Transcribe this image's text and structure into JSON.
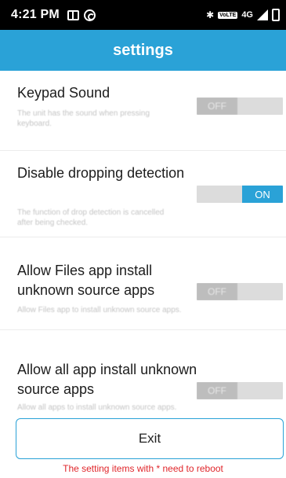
{
  "status_bar": {
    "time": "4:21 PM",
    "volte": "VoLTE",
    "network": "4G"
  },
  "header": {
    "title": "settings"
  },
  "settings": [
    {
      "title": "Keypad Sound",
      "description": "The unit has the sound when pressing keyboard.",
      "toggle": "OFF",
      "state": "off"
    },
    {
      "title": "Disable dropping detection",
      "description": "The function of drop detection is cancelled after being checked.",
      "toggle": "ON",
      "state": "on"
    },
    {
      "title": "Allow Files app install unknown source apps",
      "description": "Allow Files app to install unknown source apps.",
      "toggle": "OFF",
      "state": "off"
    },
    {
      "title": "Allow all app install unknown source apps",
      "description": "Allow all apps to install unknown source apps.",
      "toggle": "OFF",
      "state": "off"
    }
  ],
  "exit_label": "Exit",
  "footer_note": "The setting items with * need to reboot",
  "colors": {
    "accent": "#2aa2d7",
    "warning": "#e0262b"
  }
}
